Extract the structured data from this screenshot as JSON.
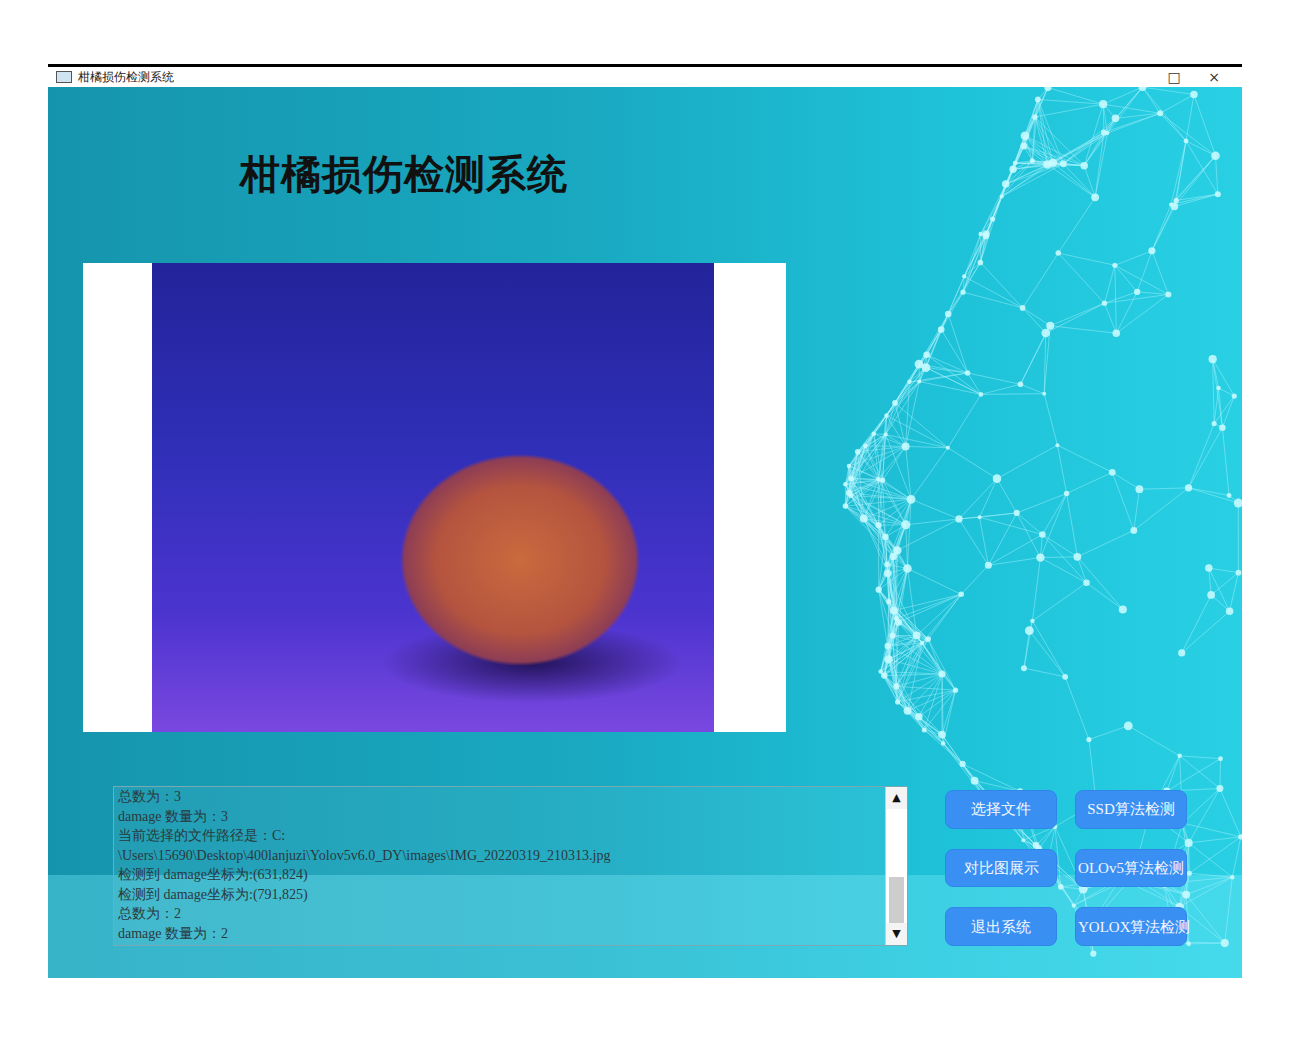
{
  "window": {
    "title": "柑橘损伤检测系统",
    "controls": [
      "□",
      "×"
    ]
  },
  "header": {
    "title": "柑橘损伤检测系统"
  },
  "log": {
    "lines": [
      "总数为：3",
      "damage 数量为：3",
      "当前选择的文件路径是：C:",
      "\\Users\\15690\\Desktop\\400lanjuzi\\Yolov5v6.0_DY\\images\\IMG_20220319_210313.jpg",
      "检测到 damage坐标为:(631,824)",
      "检测到 damage坐标为:(791,825)",
      "总数为：2",
      "damage 数量为：2"
    ],
    "scrollbar": {
      "up": "▲",
      "down": "▼",
      "level": 1
    }
  },
  "buttons": [
    {
      "label": "选择文件"
    },
    {
      "label": "SSD算法检测"
    },
    {
      "label": "对比图展示"
    },
    {
      "label": "OLOv5算法检测"
    },
    {
      "label": "退出系统"
    },
    {
      "label": "YOLOX算法检测"
    }
  ]
}
